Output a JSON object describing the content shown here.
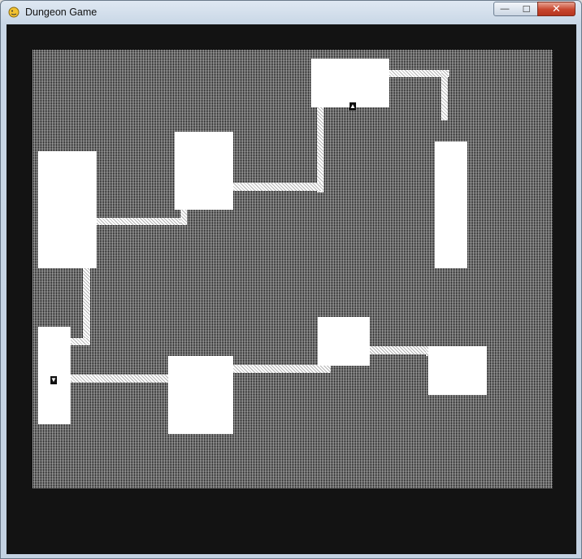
{
  "window": {
    "title": "Dungeon Game",
    "buttons": {
      "minimize": "—",
      "maximize": "☐",
      "close": "✕"
    }
  },
  "game": {
    "stairs_up_glyph": "▲",
    "stairs_down_glyph": "▼"
  },
  "colors": {
    "room": "#ffffff",
    "background": "#131313",
    "unexplored_pattern": "checker"
  },
  "icons": [
    "pygame-snake-icon",
    "stairs-up-icon",
    "stairs-down-icon"
  ]
}
